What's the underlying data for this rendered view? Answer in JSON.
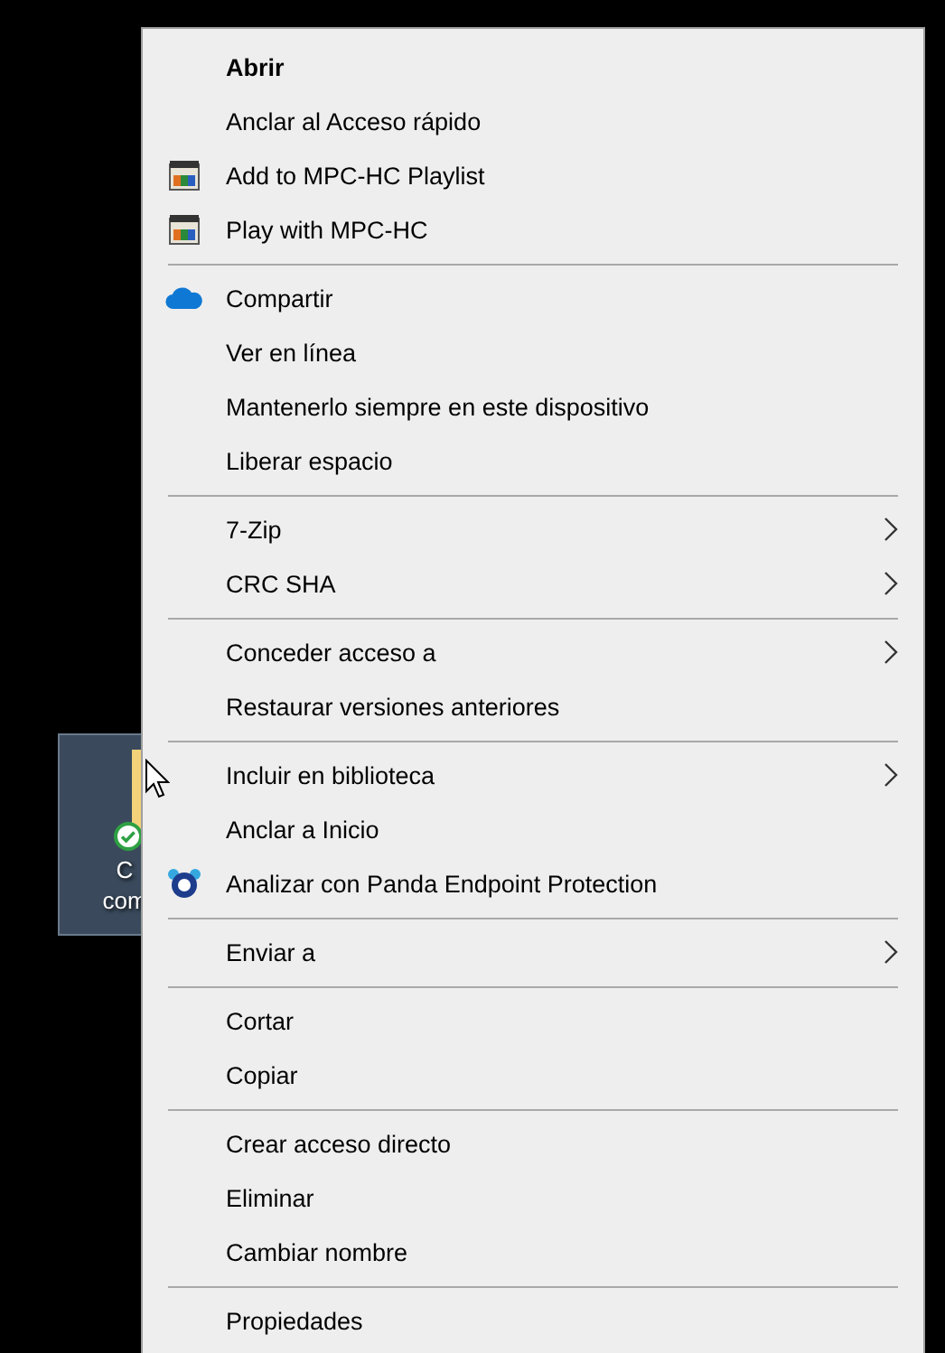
{
  "desktop_icon": {
    "label_lines": [
      "C",
      "com"
    ],
    "selected": true,
    "synced": true
  },
  "menu": {
    "groups": [
      {
        "items": [
          {
            "label": "Abrir",
            "kind": "plain",
            "default": true,
            "submenu": false
          },
          {
            "label": "Anclar al Acceso rápido",
            "kind": "plain",
            "default": false,
            "submenu": false
          },
          {
            "label": "Add to MPC-HC Playlist",
            "kind": "player",
            "default": false,
            "submenu": false
          },
          {
            "label": "Play with MPC-HC",
            "kind": "player",
            "default": false,
            "submenu": false
          }
        ]
      },
      {
        "items": [
          {
            "label": "Compartir",
            "kind": "cloud",
            "default": false,
            "submenu": false
          },
          {
            "label": "Ver en línea",
            "kind": "plain",
            "default": false,
            "submenu": false
          },
          {
            "label": "Mantenerlo siempre en este dispositivo",
            "kind": "plain",
            "default": false,
            "submenu": false
          },
          {
            "label": "Liberar espacio",
            "kind": "plain",
            "default": false,
            "submenu": false
          }
        ]
      },
      {
        "items": [
          {
            "label": "7-Zip",
            "kind": "plain",
            "default": false,
            "submenu": true
          },
          {
            "label": "CRC SHA",
            "kind": "plain",
            "default": false,
            "submenu": true
          }
        ]
      },
      {
        "items": [
          {
            "label": "Conceder acceso a",
            "kind": "plain",
            "default": false,
            "submenu": true
          },
          {
            "label": "Restaurar versiones anteriores",
            "kind": "plain",
            "default": false,
            "submenu": false
          }
        ]
      },
      {
        "items": [
          {
            "label": "Incluir en biblioteca",
            "kind": "plain",
            "default": false,
            "submenu": true
          },
          {
            "label": "Anclar a Inicio",
            "kind": "plain",
            "default": false,
            "submenu": false
          },
          {
            "label": "Analizar con Panda Endpoint Protection",
            "kind": "shield",
            "default": false,
            "submenu": false
          }
        ]
      },
      {
        "items": [
          {
            "label": "Enviar a",
            "kind": "plain",
            "default": false,
            "submenu": true
          }
        ]
      },
      {
        "items": [
          {
            "label": "Cortar",
            "kind": "plain",
            "default": false,
            "submenu": false
          },
          {
            "label": "Copiar",
            "kind": "plain",
            "default": false,
            "submenu": false
          }
        ]
      },
      {
        "items": [
          {
            "label": "Crear acceso directo",
            "kind": "plain",
            "default": false,
            "submenu": false
          },
          {
            "label": "Eliminar",
            "kind": "plain",
            "default": false,
            "submenu": false
          },
          {
            "label": "Cambiar nombre",
            "kind": "plain",
            "default": false,
            "submenu": false
          }
        ]
      },
      {
        "items": [
          {
            "label": "Propiedades",
            "kind": "plain",
            "default": false,
            "submenu": false
          }
        ]
      }
    ]
  }
}
